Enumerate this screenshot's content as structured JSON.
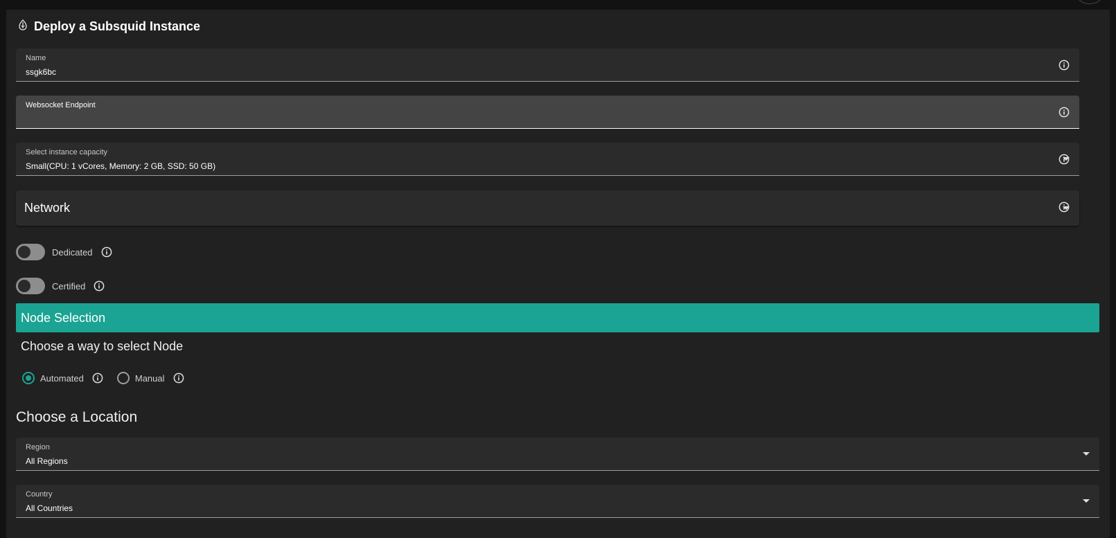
{
  "title": "Deploy a Subsquid Instance",
  "fields": {
    "name": {
      "label": "Name",
      "value": "ssgk6bc"
    },
    "websocket": {
      "label": "Websocket Endpoint",
      "value": ""
    },
    "capacity": {
      "label": "Select instance capacity",
      "value": "Small(CPU: 1 vCores, Memory: 2 GB, SSD: 50 GB)"
    },
    "network": {
      "label": "Network"
    }
  },
  "toggles": {
    "dedicated": {
      "label": "Dedicated",
      "on": false
    },
    "certified": {
      "label": "Certified",
      "on": false
    }
  },
  "node_selection": {
    "banner": "Node Selection",
    "prompt": "Choose a way to select Node",
    "options": [
      {
        "label": "Automated",
        "selected": true
      },
      {
        "label": "Manual",
        "selected": false
      }
    ]
  },
  "location": {
    "title": "Choose a Location",
    "region": {
      "label": "Region",
      "value": "All Regions"
    },
    "country": {
      "label": "Country",
      "value": "All Countries"
    }
  },
  "colors": {
    "accent": "#1ba393",
    "background": "#212121",
    "field": "#2b2b2b"
  },
  "icons": [
    "subsquid-logo-icon",
    "info-icon",
    "chevron-down-icon"
  ]
}
